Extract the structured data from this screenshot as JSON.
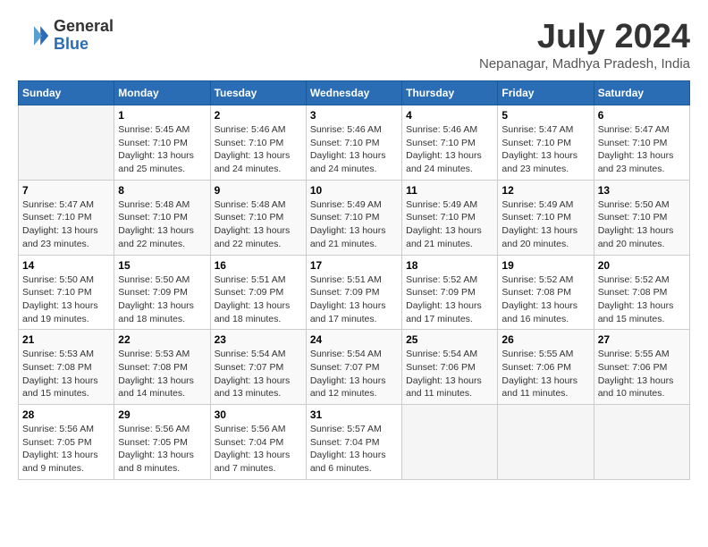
{
  "logo": {
    "general": "General",
    "blue": "Blue"
  },
  "title": "July 2024",
  "location": "Nepanagar, Madhya Pradesh, India",
  "weekdays": [
    "Sunday",
    "Monday",
    "Tuesday",
    "Wednesday",
    "Thursday",
    "Friday",
    "Saturday"
  ],
  "weeks": [
    [
      {
        "day": null,
        "info": null
      },
      {
        "day": "1",
        "info": "Sunrise: 5:45 AM\nSunset: 7:10 PM\nDaylight: 13 hours\nand 25 minutes."
      },
      {
        "day": "2",
        "info": "Sunrise: 5:46 AM\nSunset: 7:10 PM\nDaylight: 13 hours\nand 24 minutes."
      },
      {
        "day": "3",
        "info": "Sunrise: 5:46 AM\nSunset: 7:10 PM\nDaylight: 13 hours\nand 24 minutes."
      },
      {
        "day": "4",
        "info": "Sunrise: 5:46 AM\nSunset: 7:10 PM\nDaylight: 13 hours\nand 24 minutes."
      },
      {
        "day": "5",
        "info": "Sunrise: 5:47 AM\nSunset: 7:10 PM\nDaylight: 13 hours\nand 23 minutes."
      },
      {
        "day": "6",
        "info": "Sunrise: 5:47 AM\nSunset: 7:10 PM\nDaylight: 13 hours\nand 23 minutes."
      }
    ],
    [
      {
        "day": "7",
        "info": "Sunrise: 5:47 AM\nSunset: 7:10 PM\nDaylight: 13 hours\nand 23 minutes."
      },
      {
        "day": "8",
        "info": "Sunrise: 5:48 AM\nSunset: 7:10 PM\nDaylight: 13 hours\nand 22 minutes."
      },
      {
        "day": "9",
        "info": "Sunrise: 5:48 AM\nSunset: 7:10 PM\nDaylight: 13 hours\nand 22 minutes."
      },
      {
        "day": "10",
        "info": "Sunrise: 5:49 AM\nSunset: 7:10 PM\nDaylight: 13 hours\nand 21 minutes."
      },
      {
        "day": "11",
        "info": "Sunrise: 5:49 AM\nSunset: 7:10 PM\nDaylight: 13 hours\nand 21 minutes."
      },
      {
        "day": "12",
        "info": "Sunrise: 5:49 AM\nSunset: 7:10 PM\nDaylight: 13 hours\nand 20 minutes."
      },
      {
        "day": "13",
        "info": "Sunrise: 5:50 AM\nSunset: 7:10 PM\nDaylight: 13 hours\nand 20 minutes."
      }
    ],
    [
      {
        "day": "14",
        "info": "Sunrise: 5:50 AM\nSunset: 7:10 PM\nDaylight: 13 hours\nand 19 minutes."
      },
      {
        "day": "15",
        "info": "Sunrise: 5:50 AM\nSunset: 7:09 PM\nDaylight: 13 hours\nand 18 minutes."
      },
      {
        "day": "16",
        "info": "Sunrise: 5:51 AM\nSunset: 7:09 PM\nDaylight: 13 hours\nand 18 minutes."
      },
      {
        "day": "17",
        "info": "Sunrise: 5:51 AM\nSunset: 7:09 PM\nDaylight: 13 hours\nand 17 minutes."
      },
      {
        "day": "18",
        "info": "Sunrise: 5:52 AM\nSunset: 7:09 PM\nDaylight: 13 hours\nand 17 minutes."
      },
      {
        "day": "19",
        "info": "Sunrise: 5:52 AM\nSunset: 7:08 PM\nDaylight: 13 hours\nand 16 minutes."
      },
      {
        "day": "20",
        "info": "Sunrise: 5:52 AM\nSunset: 7:08 PM\nDaylight: 13 hours\nand 15 minutes."
      }
    ],
    [
      {
        "day": "21",
        "info": "Sunrise: 5:53 AM\nSunset: 7:08 PM\nDaylight: 13 hours\nand 15 minutes."
      },
      {
        "day": "22",
        "info": "Sunrise: 5:53 AM\nSunset: 7:08 PM\nDaylight: 13 hours\nand 14 minutes."
      },
      {
        "day": "23",
        "info": "Sunrise: 5:54 AM\nSunset: 7:07 PM\nDaylight: 13 hours\nand 13 minutes."
      },
      {
        "day": "24",
        "info": "Sunrise: 5:54 AM\nSunset: 7:07 PM\nDaylight: 13 hours\nand 12 minutes."
      },
      {
        "day": "25",
        "info": "Sunrise: 5:54 AM\nSunset: 7:06 PM\nDaylight: 13 hours\nand 11 minutes."
      },
      {
        "day": "26",
        "info": "Sunrise: 5:55 AM\nSunset: 7:06 PM\nDaylight: 13 hours\nand 11 minutes."
      },
      {
        "day": "27",
        "info": "Sunrise: 5:55 AM\nSunset: 7:06 PM\nDaylight: 13 hours\nand 10 minutes."
      }
    ],
    [
      {
        "day": "28",
        "info": "Sunrise: 5:56 AM\nSunset: 7:05 PM\nDaylight: 13 hours\nand 9 minutes."
      },
      {
        "day": "29",
        "info": "Sunrise: 5:56 AM\nSunset: 7:05 PM\nDaylight: 13 hours\nand 8 minutes."
      },
      {
        "day": "30",
        "info": "Sunrise: 5:56 AM\nSunset: 7:04 PM\nDaylight: 13 hours\nand 7 minutes."
      },
      {
        "day": "31",
        "info": "Sunrise: 5:57 AM\nSunset: 7:04 PM\nDaylight: 13 hours\nand 6 minutes."
      },
      {
        "day": null,
        "info": null
      },
      {
        "day": null,
        "info": null
      },
      {
        "day": null,
        "info": null
      }
    ]
  ]
}
